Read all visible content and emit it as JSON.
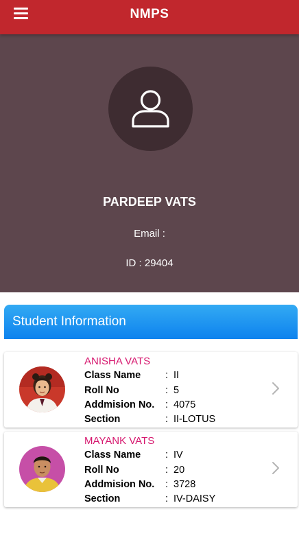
{
  "appbar": {
    "title": "NMPS"
  },
  "profile": {
    "name": "PARDEEP VATS",
    "email_text": "Email :",
    "id_text": "ID : 29404"
  },
  "section": {
    "title": "Student Information"
  },
  "labels": {
    "class_name": "Class Name",
    "roll_no": "Roll No",
    "admission_no": "Addmision No.",
    "section": "Section",
    "separator": ":"
  },
  "students": [
    {
      "name": "ANISHA  VATS",
      "class_name": "II",
      "roll_no": "5",
      "admission_no": "4075",
      "section": "II-LOTUS"
    },
    {
      "name": "MAYANK VATS",
      "class_name": "IV",
      "roll_no": "20",
      "admission_no": "3728",
      "section": "IV-DAISY"
    }
  ],
  "colors": {
    "appbar": "#c1272d",
    "profile_bg": "#5d464d",
    "header_blue": "#1b8ff0",
    "name_pink": "#d6176e"
  }
}
